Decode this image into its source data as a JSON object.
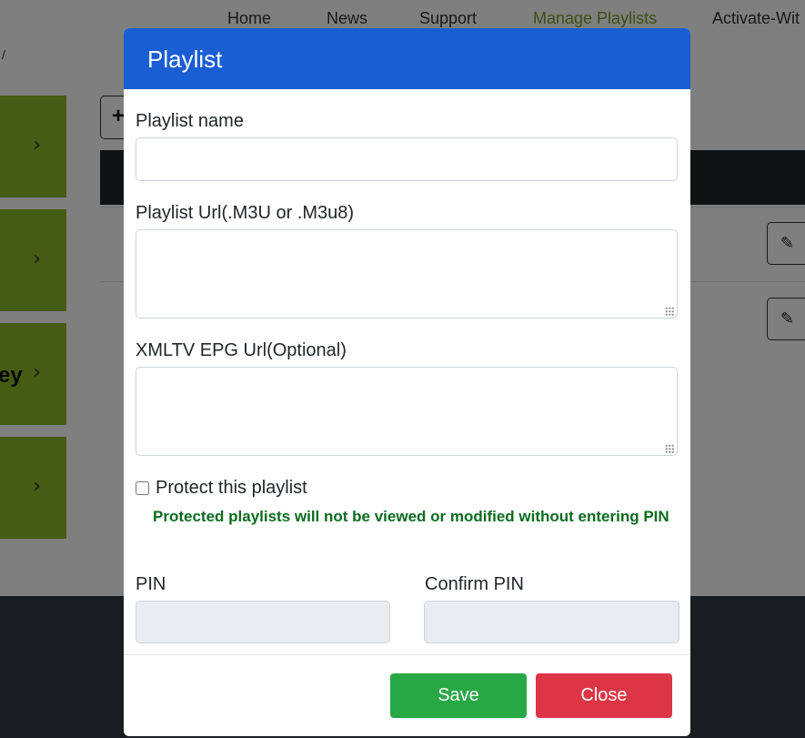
{
  "nav": {
    "items": [
      {
        "label": "Home"
      },
      {
        "label": "News"
      },
      {
        "label": "Support"
      },
      {
        "label": "Manage Playlists",
        "active": true
      },
      {
        "label": "Activate-Wit"
      }
    ],
    "stray": "/"
  },
  "sidebar": {
    "cards": [
      {
        "partial": "",
        "chevron": "›"
      },
      {
        "partial": "",
        "chevron": "›"
      },
      {
        "partial": "ey",
        "chevron": "›"
      },
      {
        "partial": "",
        "chevron": "›"
      }
    ]
  },
  "toolbar": {
    "add_glyph": "+"
  },
  "table": {
    "edit_glyph": "✎"
  },
  "modal": {
    "title": "Playlist",
    "fields": {
      "name_label": "Playlist name",
      "name_value": "",
      "url_label": "Playlist Url(.M3U or .M3u8)",
      "url_value": "",
      "epg_label": "XMLTV EPG Url(Optional)",
      "epg_value": ""
    },
    "protect": {
      "label": "Protect this playlist",
      "checked": false,
      "help": "Protected playlists will not be viewed or modified without entering PIN"
    },
    "pin": {
      "pin_label": "PIN",
      "confirm_label": "Confirm PIN"
    },
    "buttons": {
      "save": "Save",
      "close": "Close"
    }
  },
  "colors": {
    "header_blue": "#1a5ed4",
    "save_green": "#28a745",
    "close_red": "#dc3545",
    "help_green": "#0a6b1f",
    "side_green": "#8db627",
    "nav_active": "#7f9d2c"
  }
}
